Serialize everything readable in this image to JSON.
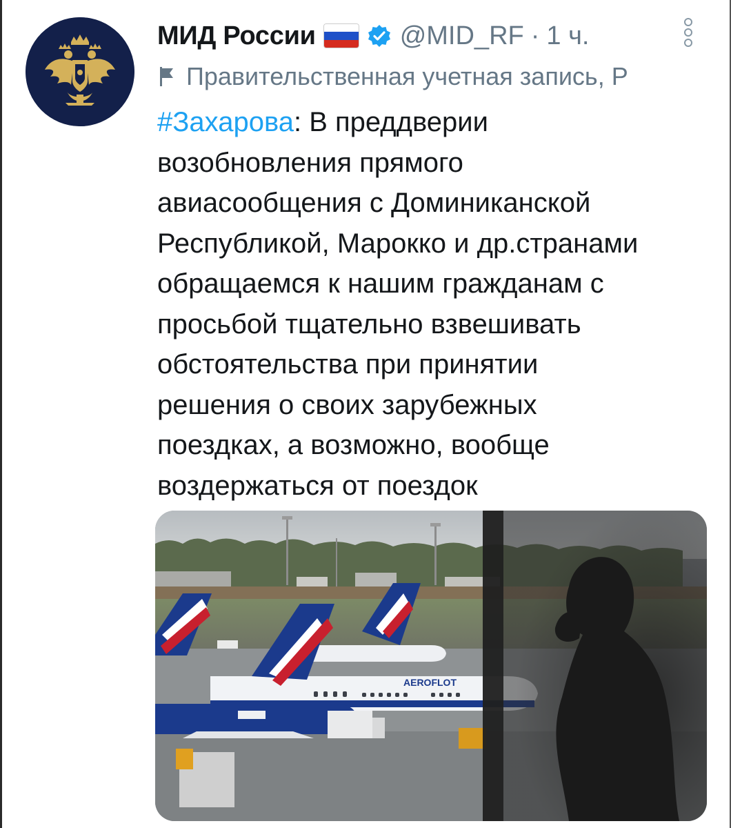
{
  "tweet": {
    "display_name": "МИД России",
    "flag_emoji": "russia-flag-icon",
    "handle": "@MID_RF",
    "separator": "·",
    "time": "1 ч.",
    "account_label": "Правительственная учетная запись, Р",
    "hashtag": "#Захарова",
    "body_lines": [
      ": В преддверии",
      "возобновления прямого",
      "авиасообщения с Доминиканской",
      "Республикой, Марокко и др.странами",
      "обращаемся к нашим гражданам с",
      "просьбой тщательно взвешивать",
      "обстоятельства при принятии",
      "решения о своих зарубежных",
      "поездках, а возможно, вообще",
      "воздержаться от поездок"
    ],
    "media": {
      "description_icon": "airport-photo",
      "aircraft_text": "AEROFLOT"
    }
  },
  "colors": {
    "link": "#1da1f2",
    "secondary": "#657786",
    "verified": "#1da1f2",
    "avatar_bg": "#13204a",
    "emblem_gold": "#d4b15a"
  }
}
